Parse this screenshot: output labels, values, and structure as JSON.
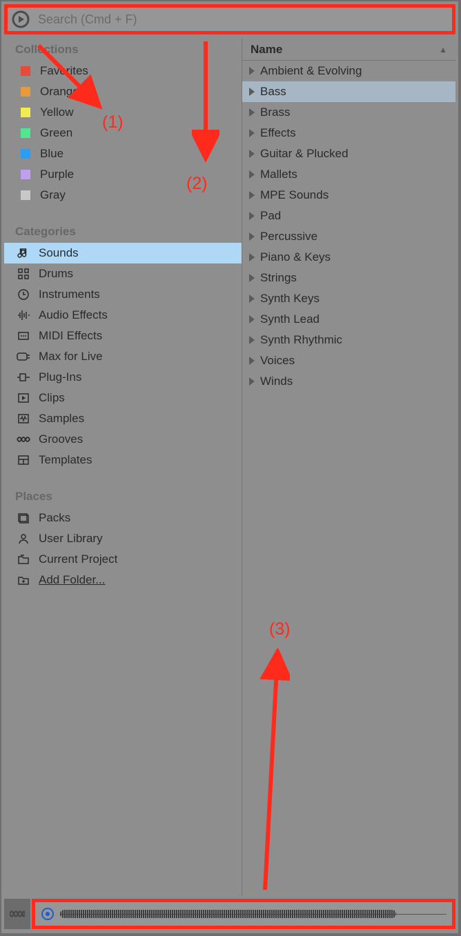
{
  "search": {
    "placeholder": "Search (Cmd + F)"
  },
  "sidebar": {
    "sections": {
      "collections": {
        "title": "Collections",
        "items": [
          {
            "label": "Favorites",
            "color": "#e84a3a"
          },
          {
            "label": "Orange",
            "color": "#e89a3a"
          },
          {
            "label": "Yellow",
            "color": "#f2ed4d"
          },
          {
            "label": "Green",
            "color": "#4de88f"
          },
          {
            "label": "Blue",
            "color": "#2a9df4"
          },
          {
            "label": "Purple",
            "color": "#c29ef0"
          },
          {
            "label": "Gray",
            "color": "#c8c8c8"
          }
        ]
      },
      "categories": {
        "title": "Categories",
        "items": [
          {
            "label": "Sounds",
            "icon": "note",
            "selected": true
          },
          {
            "label": "Drums",
            "icon": "grid"
          },
          {
            "label": "Instruments",
            "icon": "clock"
          },
          {
            "label": "Audio Effects",
            "icon": "wave"
          },
          {
            "label": "MIDI Effects",
            "icon": "midi"
          },
          {
            "label": "Max for Live",
            "icon": "max"
          },
          {
            "label": "Plug-Ins",
            "icon": "plug"
          },
          {
            "label": "Clips",
            "icon": "clip"
          },
          {
            "label": "Samples",
            "icon": "sample"
          },
          {
            "label": "Grooves",
            "icon": "groove"
          },
          {
            "label": "Templates",
            "icon": "template"
          }
        ]
      },
      "places": {
        "title": "Places",
        "items": [
          {
            "label": "Packs",
            "icon": "packs"
          },
          {
            "label": "User Library",
            "icon": "user"
          },
          {
            "label": "Current Project",
            "icon": "folder"
          },
          {
            "label": "Add Folder...",
            "icon": "addfolder",
            "underline": true
          }
        ]
      }
    }
  },
  "content": {
    "column_header": "Name",
    "items": [
      {
        "label": "Ambient & Evolving"
      },
      {
        "label": "Bass",
        "selected": true
      },
      {
        "label": "Brass"
      },
      {
        "label": "Effects"
      },
      {
        "label": "Guitar & Plucked"
      },
      {
        "label": "Mallets"
      },
      {
        "label": "MPE Sounds"
      },
      {
        "label": "Pad"
      },
      {
        "label": "Percussive"
      },
      {
        "label": "Piano & Keys"
      },
      {
        "label": "Strings"
      },
      {
        "label": "Synth Keys"
      },
      {
        "label": "Synth Lead"
      },
      {
        "label": "Synth Rhythmic"
      },
      {
        "label": "Voices"
      },
      {
        "label": "Winds"
      }
    ]
  },
  "annotations": {
    "a1": "(1)",
    "a2": "(2)",
    "a3": "(3)"
  }
}
